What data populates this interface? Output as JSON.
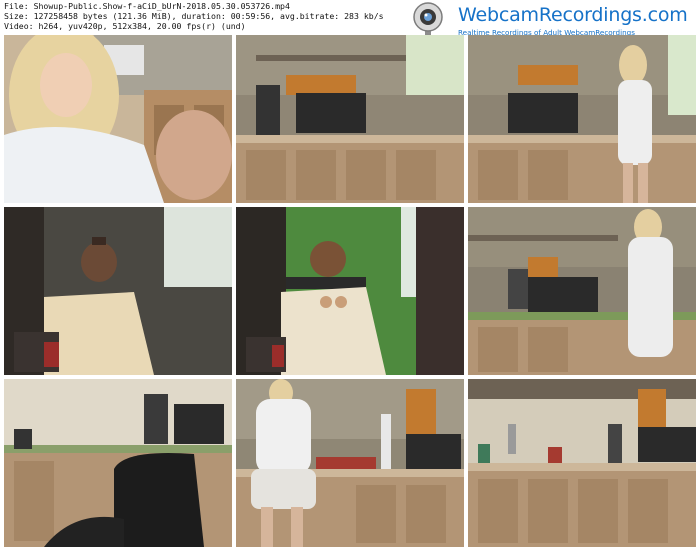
{
  "header": {
    "file_line": "File: Showup-Public.Show-f-aCiD_bUrN-2018.05.30.053726.mp4",
    "size_line": "Size: 127258458 bytes (121.36 MiB), duration: 00:59:56, avg.bitrate: 283 kb/s",
    "video_line": "Video: h264, yuv420p, 512x384, 20.00 fps(r) (und)"
  },
  "logo": {
    "brand": "WebcamRecordings.com",
    "tagline": "Realtime Recordings of Adult WebcamRecordings",
    "icon": "webcam-icon",
    "color": "#1672c8"
  },
  "thumbnails": [
    {
      "scene": "woman-close-up-kitchen"
    },
    {
      "scene": "kitchen-counter-shelves"
    },
    {
      "scene": "woman-standing-kitchen"
    },
    {
      "scene": "kettle-counter-dark"
    },
    {
      "scene": "kettle-green-wall"
    },
    {
      "scene": "woman-at-counter-side"
    },
    {
      "scene": "kitchen-chair-foreground"
    },
    {
      "scene": "woman-back-at-sink"
    },
    {
      "scene": "kitchen-sink-cabinets"
    }
  ]
}
